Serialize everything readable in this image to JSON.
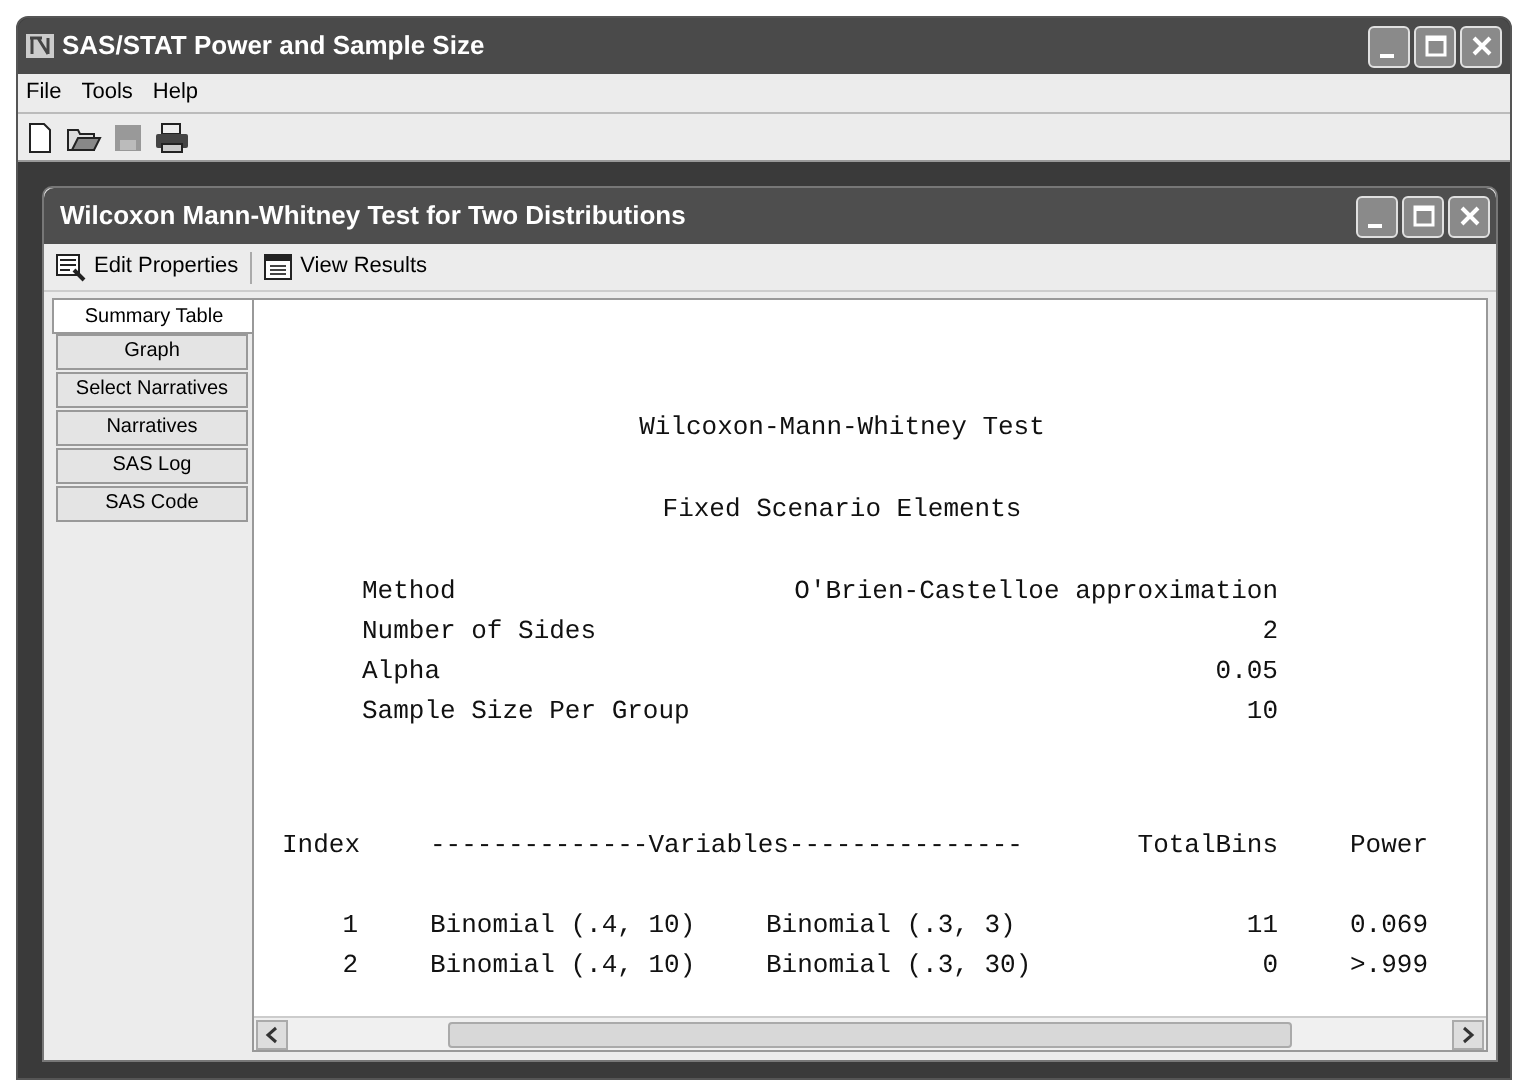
{
  "window": {
    "title": "SAS/STAT Power and Sample Size"
  },
  "menu": [
    "File",
    "Tools",
    "Help"
  ],
  "inner_window": {
    "title": "Wilcoxon Mann-Whitney Test for Two Distributions"
  },
  "inner_toolbar": [
    {
      "label": "Edit Properties"
    },
    {
      "label": "View Results"
    }
  ],
  "tabs": [
    {
      "label": "Summary Table",
      "selected": true
    },
    {
      "label": "Graph",
      "selected": false
    },
    {
      "label": "Select Narratives",
      "selected": false
    },
    {
      "label": "Narratives",
      "selected": false
    },
    {
      "label": "SAS Log",
      "selected": false
    },
    {
      "label": "SAS Code",
      "selected": false
    }
  ],
  "report": {
    "title": "Wilcoxon-Mann-Whitney Test",
    "subtitle": "Fixed Scenario Elements",
    "scenario": [
      {
        "label": "Method",
        "value": "O'Brien-Castelloe approximation"
      },
      {
        "label": "Number of Sides",
        "value": "2"
      },
      {
        "label": "Alpha",
        "value": "0.05"
      },
      {
        "label": "Sample Size Per Group",
        "value": "10"
      }
    ],
    "columns": [
      "Index",
      "--------------Variables---------------",
      "",
      "TotalBins",
      "Power"
    ],
    "rows": [
      [
        "1",
        "Binomial (.4, 10)",
        "Binomial (.3, 3)",
        "11",
        "0.069"
      ],
      [
        "2",
        "Binomial (.4, 10)",
        "Binomial (.3, 30)",
        "0",
        ">.999"
      ]
    ]
  }
}
